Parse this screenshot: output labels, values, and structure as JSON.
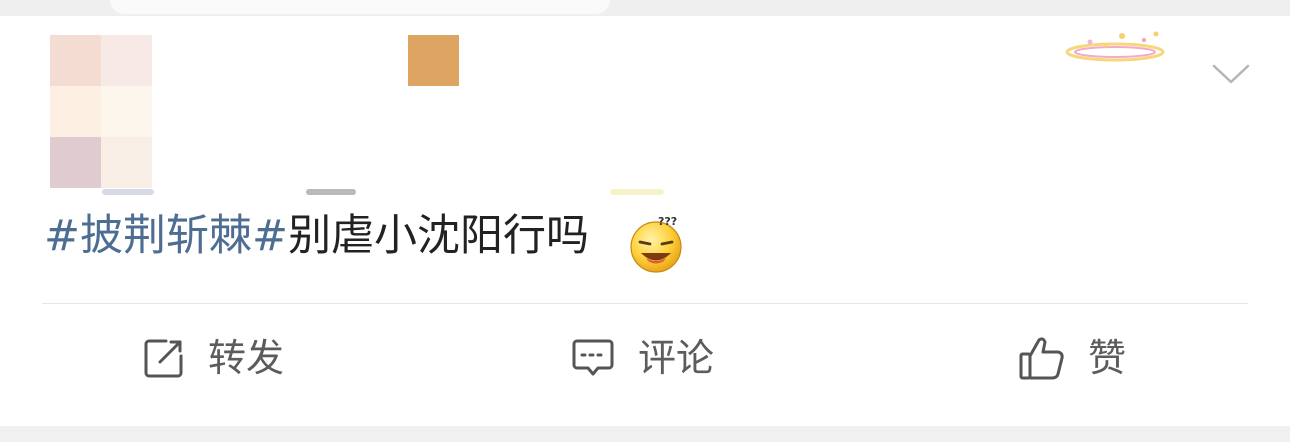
{
  "post": {
    "topic": "#披荆斩棘#",
    "text": "别虐小沈阳行吗",
    "emoji": "dizzy-smile-emoji"
  },
  "actions": {
    "repost_label": "转发",
    "comment_label": "评论",
    "like_label": "赞"
  },
  "icons": {
    "repost": "share-edit-icon",
    "comment": "comment-bubble-icon",
    "like": "thumbs-up-icon",
    "more": "chevron-down-icon"
  },
  "colors": {
    "topic": "#4e6d93",
    "text": "#222222",
    "action_label": "#5c5c5c",
    "badge": "#dea462"
  }
}
